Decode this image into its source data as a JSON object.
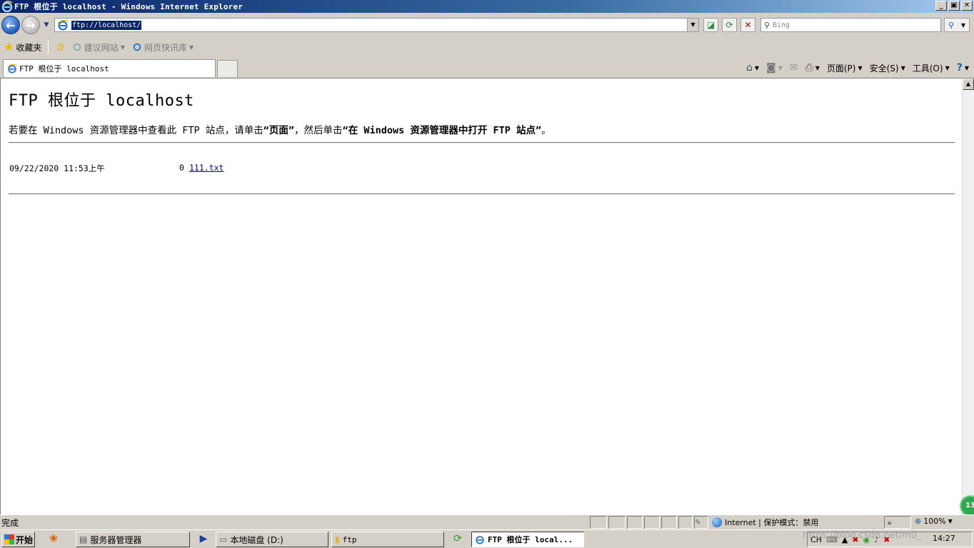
{
  "window": {
    "title": "FTP 根位于 localhost - Windows Internet Explorer",
    "buttons": [
      "_",
      "▣",
      "✕"
    ]
  },
  "address_bar": {
    "url": "ftp://localhost/",
    "search_placeholder": "Bing"
  },
  "favorites_bar": {
    "favorites_label": "收藏夹",
    "items": [
      {
        "label": "建议网站"
      },
      {
        "label": "网页快讯库"
      }
    ]
  },
  "tabs": [
    {
      "label": "FTP 根位于 localhost"
    }
  ],
  "command_bar": {
    "page_label": "页面(P)",
    "safety_label": "安全(S)",
    "tools_label": "工具(O)"
  },
  "page": {
    "heading": "FTP 根位于 localhost",
    "instruction_prefix": "若要在 Windows 资源管理器中查看此 FTP 站点，请单击",
    "instruction_page": "“页面”",
    "instruction_middle": "，然后单击",
    "instruction_open": "“在 Windows 资源管理器中打开 FTP 站点”",
    "instruction_suffix": "。",
    "files": [
      {
        "date": "09/22/2020 11:53上午",
        "size": "0",
        "name": "111.txt"
      }
    ]
  },
  "status_bar": {
    "status": "完成",
    "zone": "Internet | 保护模式：禁用",
    "zoom": "100%"
  },
  "taskbar": {
    "start_label": "开始",
    "buttons": [
      {
        "label": "服务器管理器"
      },
      {
        "label": "本地磁盘 (D:)"
      },
      {
        "label": "ftp"
      },
      {
        "label": "FTP 根位于 local..."
      }
    ],
    "lang": "CH",
    "clock": "14:27",
    "watermark": "https://blog.csdn.net/m0_"
  },
  "badge": "13"
}
